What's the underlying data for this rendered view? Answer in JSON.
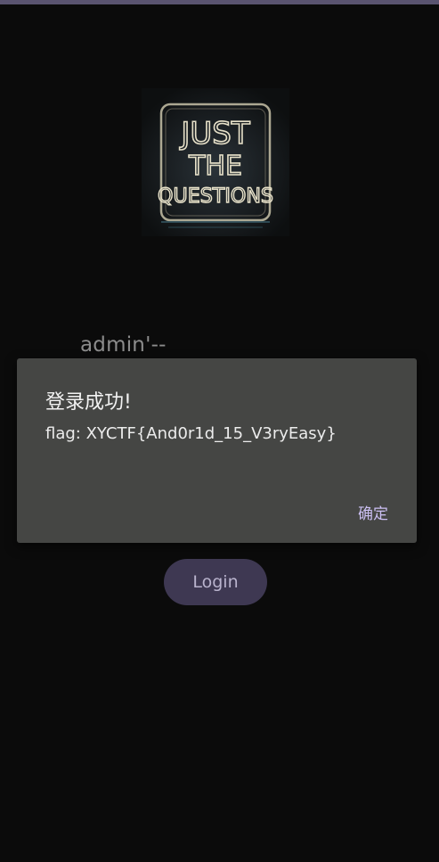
{
  "login_form": {
    "username_value": "admin'--",
    "login_label": "Login"
  },
  "logo": {
    "line1": "JUST",
    "line2": "THE",
    "line3": "QUESTIONS"
  },
  "dialog": {
    "title": "登录成功!",
    "message": "flag: XYCTF{And0r1d_15_V3ryEasy}",
    "ok_label": "确定"
  },
  "colors": {
    "background": "#0b0b0b",
    "dialog_background": "#454644",
    "accent": "#cbbff2",
    "button_background": "#3e3852"
  }
}
